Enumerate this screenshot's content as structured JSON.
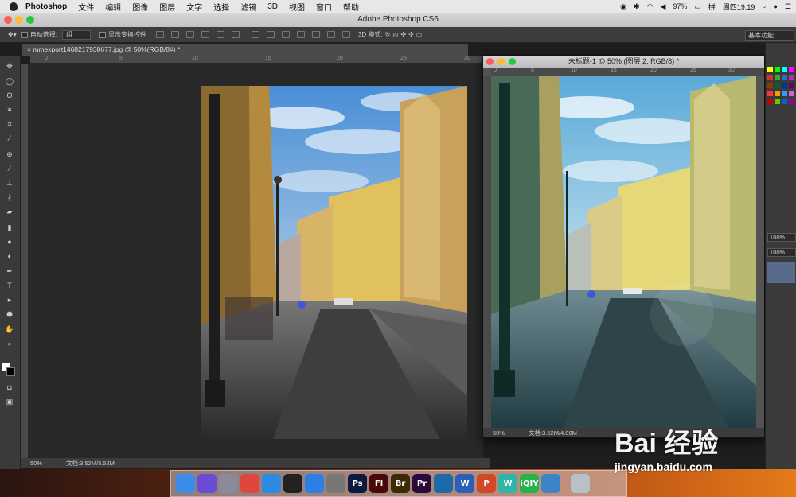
{
  "menubar": {
    "app": "Photoshop",
    "items": [
      "文件",
      "编辑",
      "图像",
      "图层",
      "文字",
      "选择",
      "滤镜",
      "3D",
      "视图",
      "窗口",
      "帮助"
    ],
    "battery": "97%",
    "clock": "周四19:19"
  },
  "window": {
    "title": "Adobe Photoshop CS6"
  },
  "options": {
    "auto_select_label": "自动选择:",
    "auto_select_value": "组",
    "show_transform_label": "显示变换控件",
    "mode_3d_label": "3D 模式:",
    "workspace": "基本功能"
  },
  "doc1": {
    "tab_title": "mmexport1468217938677.jpg @ 50%(RGB/8#) *",
    "ruler_ticks": [
      "0",
      "5",
      "10",
      "15",
      "20",
      "25",
      "30"
    ],
    "zoom": "50%",
    "doc_size": "文档:3.52M/3.52M"
  },
  "doc2": {
    "title": "未标题-1 @ 50% (图层 2, RGB/8) *",
    "ruler_ticks": [
      "0",
      "5",
      "10",
      "15",
      "20",
      "25",
      "30"
    ],
    "zoom": "50%",
    "doc_size": "文档:3.52M/4.00M"
  },
  "panels": {
    "opacity": "100%",
    "fill": "100%"
  },
  "dock": {
    "apps": [
      {
        "name": "finder",
        "label": "",
        "color": "#3b8ee8"
      },
      {
        "name": "siri",
        "label": "",
        "color": "#6a4bd6"
      },
      {
        "name": "launchpad",
        "label": "",
        "color": "#8a8a9a"
      },
      {
        "name": "chrome",
        "label": "",
        "color": "#e0473c"
      },
      {
        "name": "safari",
        "label": "",
        "color": "#2a8be0"
      },
      {
        "name": "qq",
        "label": "",
        "color": "#222222"
      },
      {
        "name": "app-store",
        "label": "",
        "color": "#2d7fe6"
      },
      {
        "name": "system-preferences",
        "label": "",
        "color": "#777777"
      },
      {
        "name": "photoshop",
        "label": "Ps",
        "color": "#0b1a3a"
      },
      {
        "name": "flash",
        "label": "Fl",
        "color": "#4a0808"
      },
      {
        "name": "bridge",
        "label": "Br",
        "color": "#3a2a05"
      },
      {
        "name": "premiere",
        "label": "Pr",
        "color": "#2a0a3a"
      },
      {
        "name": "browser",
        "label": "",
        "color": "#1c6aa8"
      },
      {
        "name": "word",
        "label": "W",
        "color": "#2b5fb8"
      },
      {
        "name": "powerpoint",
        "label": "P",
        "color": "#d24726"
      },
      {
        "name": "wps",
        "label": "W",
        "color": "#2fb5a8"
      },
      {
        "name": "iqiyi",
        "label": "iQIY",
        "color": "#26b34a"
      },
      {
        "name": "wunderlist",
        "label": "",
        "color": "#3c84c8"
      },
      {
        "name": "trash",
        "label": "",
        "color": "#b8c0c8"
      }
    ]
  },
  "watermark": {
    "big": "Bai 经验",
    "small": "jingyan.baidu.com"
  }
}
